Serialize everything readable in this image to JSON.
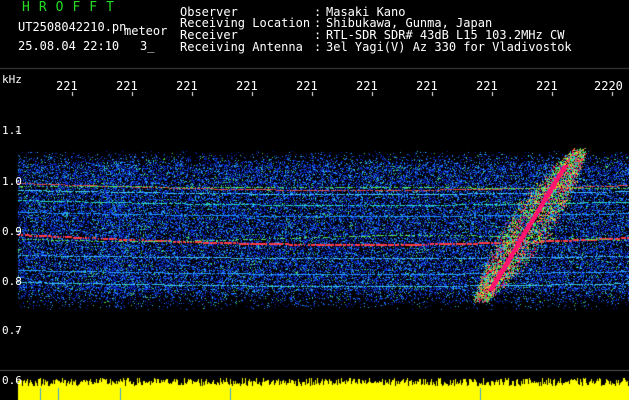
{
  "header": {
    "title": "HROFFT",
    "filename": "UT2508042210.pn",
    "mode": "meteor",
    "datetime": "25.08.04 22:10",
    "interval": "3_",
    "fields": [
      {
        "label": "Observer",
        "sep": ":",
        "value": "Masaki Kano"
      },
      {
        "label": "Receiving Location",
        "sep": ":",
        "value": "Shibukawa, Gunma, Japan"
      },
      {
        "label": "Receiver",
        "sep": ":",
        "value": "RTL-SDR SDR# 43dB L15 103.2MHz CW"
      },
      {
        "label": "Receiving Antenna",
        "sep": ":",
        "value": "3el Yagi(V) Az 330 for Vladivostok"
      }
    ]
  },
  "axes": {
    "y_unit": "kHz",
    "y_ticks": [
      "1.1",
      "1.0",
      "0.9",
      "0.8",
      "0.7",
      "0.6"
    ],
    "x_ticks": [
      "221",
      "221",
      "221",
      "221",
      "221",
      "221",
      "221",
      "221",
      "221",
      "2220"
    ]
  },
  "colors": {
    "text": "#ffffff",
    "title": "#22dd22",
    "background": "#000000",
    "noise": "#1030d0",
    "signal_red": "#ff2040",
    "signal_green": "#30ff60",
    "level_yellow": "#ffff00"
  }
}
